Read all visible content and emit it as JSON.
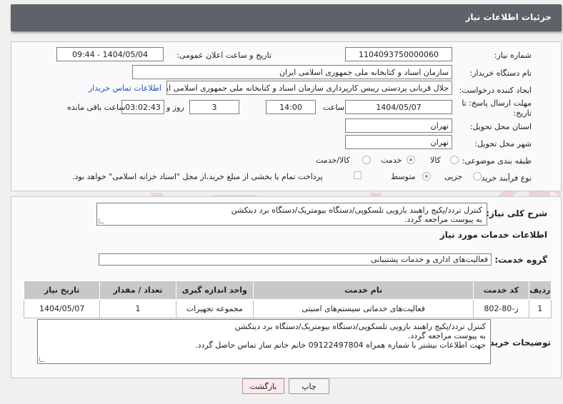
{
  "header": {
    "title": "جزئیات اطلاعات نیاز"
  },
  "fields": {
    "need_number_label": "شماره نیاز:",
    "need_number": "1104093750000060",
    "announce_label": "تاریخ و ساعت اعلان عمومی:",
    "announce_value": "1404/05/04 - 09:44",
    "buyer_org_label": "نام دستگاه خریدار:",
    "buyer_org": "سازمان اسناد و کتابخانه ملی جمهوری اسلامی ایران",
    "creator_label": "ایجاد کننده درخواست:",
    "creator": "جلال قربانی پردستی رییس کارپردازی سازمان اسناد و کتابخانه ملی جمهوری اسلامی ایران",
    "contact_link": "اطلاعات تماس خریدار",
    "deadline_label_1": "مهلت ارسال پاسخ: تا",
    "deadline_label_2": "تاریخ:",
    "deadline_date": "1404/05/07",
    "time_label": "ساعت",
    "deadline_time": "14:00",
    "days_value": "3",
    "days_label": "روز و",
    "remaining_value": "03:02:43",
    "remaining_label": "ساعت باقی مانده",
    "province_label": "استان محل تحویل:",
    "province": "تهران",
    "city_label": "شهر محل تحویل:",
    "city": "تهران",
    "category_label": "طبقه بندی موضوعی:",
    "category_options": [
      "کالا",
      "خدمت",
      "کالا/خدمت"
    ],
    "category_selected": 1,
    "process_label": "نوع فرآیند خرید :",
    "process_options": [
      "جزیی",
      "متوسط"
    ],
    "process_selected": 0,
    "payment_text": "پرداخت تمام یا بخشی از مبلغ خرید،از محل \"اسناد خزانه اسلامی\" خواهد بود."
  },
  "summary": {
    "label": "شرح کلی نیاز:",
    "line1": "کنترل تردد/پکیج راهبند بازویی تلسکوپی/دستگاه بیومتریک/دستگاه برد دیتکشن",
    "line2": "به پیوست مراجعه گردد."
  },
  "services": {
    "section_title": "اطلاعات خدمات مورد نیاز",
    "group_label": "گروه خدمت:",
    "group_value": "فعالیت‌های اداری و خدمات پشتیبانی",
    "columns": [
      "ردیف",
      "کد خدمت",
      "نام خدمت",
      "واحد اندازه گیری",
      "تعداد / مقدار",
      "تاریخ نیاز"
    ],
    "rows": [
      {
        "row": "1",
        "code": "ز-80-802",
        "name": "فعالیت‌های خدماتی سیستم‌های امنیتی",
        "unit": "مجموعه تجهیزات",
        "qty": "1",
        "date": "1404/05/07"
      }
    ]
  },
  "buyer_notes": {
    "label": "توضیحات خریدار:",
    "line1": "کنترل تردد/پکیج راهبند بازویی تلسکوپی/دستگاه بیومتریک/دستگاه برد دیتکشن",
    "line2": "به پیوست مراجعه گردد.",
    "line3": "جهت اطلاعات بیشتر با شماره همراه 09122497804 خانم خاتم ساز تماس حاصل گردد."
  },
  "buttons": {
    "print": "چاپ",
    "back": "بازگشت"
  },
  "colors": {
    "header": "#5f6268",
    "link": "#1a56c4",
    "back_button": "#fde8ea"
  }
}
